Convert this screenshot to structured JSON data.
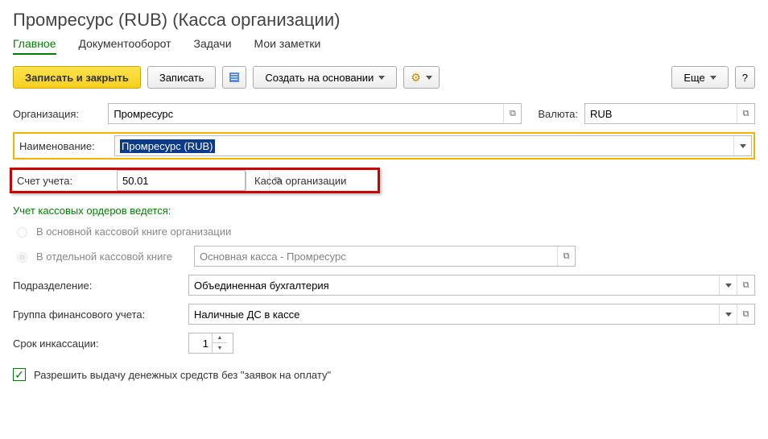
{
  "title": "Промресурс (RUB) (Касса организации)",
  "tabs": {
    "main": "Главное",
    "docflow": "Документооборот",
    "tasks": "Задачи",
    "notes": "Мои заметки"
  },
  "toolbar": {
    "save_close": "Записать и закрыть",
    "save": "Записать",
    "create_based": "Создать на основании",
    "more": "Еще",
    "help": "?"
  },
  "fields": {
    "org_label": "Организация:",
    "org_value": "Промресурс",
    "currency_label": "Валюта:",
    "currency_value": "RUB",
    "name_label": "Наименование:",
    "name_value": "Промресурс (RUB)",
    "account_label": "Счет учета:",
    "account_value": "50.01",
    "account_desc": "Касса организации",
    "section": "Учет кассовых ордеров ведется:",
    "radio1": "В основной кассовой книге организации",
    "radio2": "В отдельной кассовой книге",
    "book_value": "Основная касса - Промресурс",
    "dept_label": "Подразделение:",
    "dept_value": "Объединенная бухгалтерия",
    "fin_group_label": "Группа финансового учета:",
    "fin_group_value": "Наличные ДС в кассе",
    "collection_label": "Срок инкассации:",
    "collection_value": "1",
    "allow_label": "Разрешить выдачу денежных средств без \"заявок на оплату\""
  }
}
